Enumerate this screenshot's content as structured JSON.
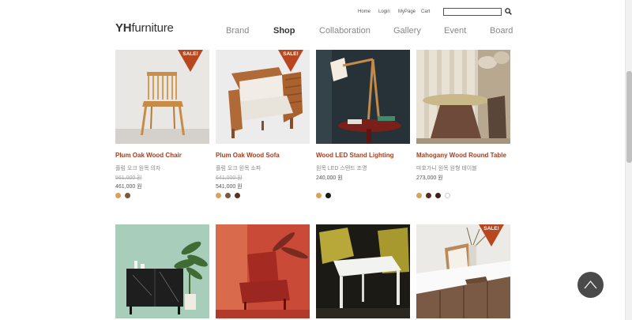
{
  "util_nav": [
    "Home",
    "Login",
    "MyPage",
    "Cart"
  ],
  "search": {
    "placeholder": ""
  },
  "logo": {
    "bold": "YH",
    "rest": "furniture"
  },
  "nav": [
    "Brand",
    "Shop",
    "Collaboration",
    "Gallery",
    "Event",
    "Board"
  ],
  "nav_active": "Shop",
  "sale_label": "SALE!",
  "products": [
    {
      "name": "Plum Oak Wood Chair",
      "kor": "플럼 오크 원목 의자",
      "old_price": "561,000 원",
      "price": "461,000 원",
      "sale": true,
      "swatches": [
        "#d9a15c",
        "#7a5a3c"
      ]
    },
    {
      "name": "Plum Oak Wood Sofa",
      "kor": "플럼 오크 원목 소파",
      "old_price": "641,000 원",
      "price": "541,000 원",
      "sale": true,
      "swatches": [
        "#d9a15c",
        "#7a5a3c",
        "#5a3222"
      ]
    },
    {
      "name": "Wood LED Stand Lighting",
      "kor": "원목 LED 스탠드 조명",
      "old_price": "",
      "price": "240,000 원",
      "sale": false,
      "swatches": [
        "#d9a15c",
        "#1a1a1a"
      ]
    },
    {
      "name": "Mahogany Wood Round Table",
      "kor": "마호가니 원목 원형 테이블",
      "old_price": "",
      "price": "273,000 원",
      "sale": false,
      "swatches": [
        "#d9a15c",
        "#5a2a1e",
        "#3a2418",
        "#ffffff"
      ]
    },
    {
      "name": "",
      "kor": "",
      "old_price": "",
      "price": "",
      "sale": false,
      "swatches": []
    },
    {
      "name": "",
      "kor": "",
      "old_price": "",
      "price": "",
      "sale": false,
      "swatches": []
    },
    {
      "name": "",
      "kor": "",
      "old_price": "",
      "price": "",
      "sale": false,
      "swatches": []
    },
    {
      "name": "",
      "kor": "",
      "old_price": "",
      "price": "",
      "sale": true,
      "swatches": []
    }
  ]
}
